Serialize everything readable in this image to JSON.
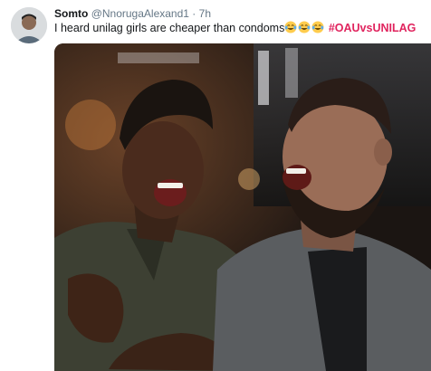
{
  "tweet": {
    "display_name": "Somto",
    "handle": "@NnorugaAlexand1",
    "separator": "·",
    "time": "7h",
    "text": "I heard unilag girls are cheaper than condoms",
    "emojis": [
      "face-with-tears-of-joy",
      "face-with-tears-of-joy",
      "face-with-tears-of-joy"
    ],
    "hashtag": "#OAUvsUNILAG",
    "hashtag_color": "#e0245e",
    "media_description": "photo-two-men-laughing"
  }
}
